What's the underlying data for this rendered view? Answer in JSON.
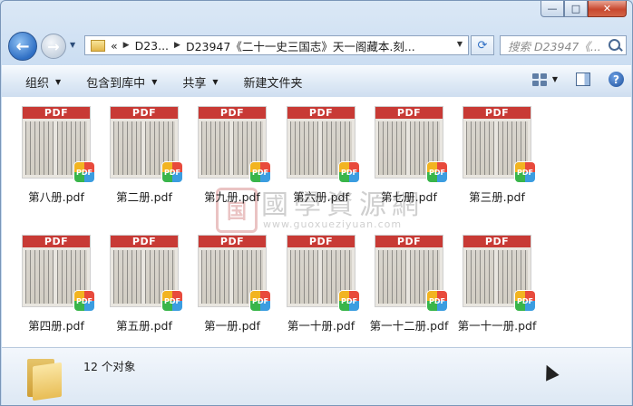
{
  "window": {
    "caption_buttons": {
      "minimize": "—",
      "maximize": "□",
      "close": "✕"
    }
  },
  "nav": {
    "back_glyph": "←",
    "forward_glyph": "→",
    "address": {
      "overflow": "«",
      "crumbs": [
        "D23...",
        "D23947《二十一史三国志》天一阁藏本.刻..."
      ]
    },
    "refresh_glyph": "⟳",
    "search_placeholder": "搜索 D23947《..."
  },
  "toolbar": {
    "organize": "组织",
    "include_in_library": "包含到库中",
    "share": "共享",
    "new_folder": "新建文件夹",
    "help": "?"
  },
  "watermark": {
    "seal": "国",
    "title": "國學資源網",
    "url": "www.guoxueziyuan.com"
  },
  "files": [
    {
      "name": "第八册.pdf",
      "thumb_label": "PDF",
      "badge": "PDF"
    },
    {
      "name": "第二册.pdf",
      "thumb_label": "PDF",
      "badge": "PDF"
    },
    {
      "name": "第九册.pdf",
      "thumb_label": "PDF",
      "badge": "PDF"
    },
    {
      "name": "第六册.pdf",
      "thumb_label": "PDF",
      "badge": "PDF"
    },
    {
      "name": "第七册.pdf",
      "thumb_label": "PDF",
      "badge": "PDF"
    },
    {
      "name": "第三册.pdf",
      "thumb_label": "PDF",
      "badge": "PDF"
    },
    {
      "name": "第四册.pdf",
      "thumb_label": "PDF",
      "badge": "PDF"
    },
    {
      "name": "第五册.pdf",
      "thumb_label": "PDF",
      "badge": "PDF"
    },
    {
      "name": "第一册.pdf",
      "thumb_label": "PDF",
      "badge": "PDF"
    },
    {
      "name": "第一十册.pdf",
      "thumb_label": "PDF",
      "badge": "PDF"
    },
    {
      "name": "第一十二册.pdf",
      "thumb_label": "PDF",
      "badge": "PDF"
    },
    {
      "name": "第一十一册.pdf",
      "thumb_label": "PDF",
      "badge": "PDF"
    }
  ],
  "status": {
    "item_count": "12 个对象"
  },
  "colors": {
    "pdf_header": "#c83a35",
    "window_chrome": "#dbe8f6"
  }
}
